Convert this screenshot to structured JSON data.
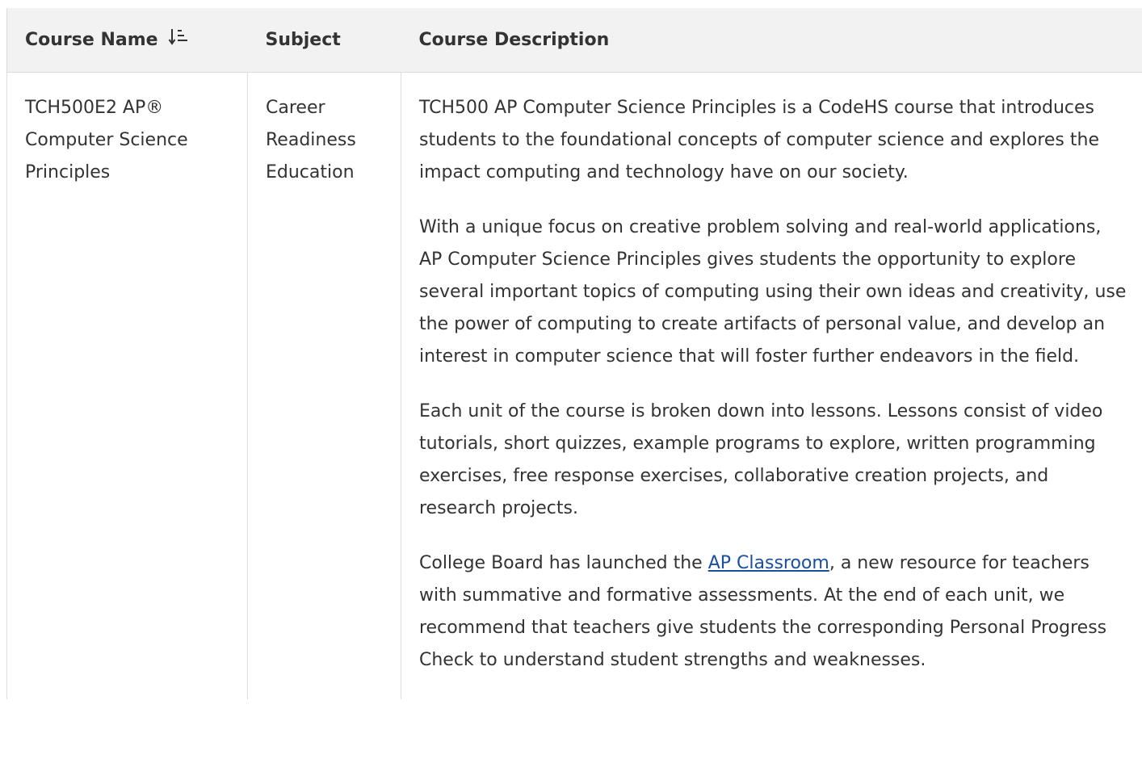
{
  "table": {
    "headers": {
      "course_name": "Course Name",
      "subject": "Subject",
      "description": "Course Description"
    },
    "sort_icon": "sort-ascending-icon",
    "rows": [
      {
        "course_name": "TCH500E2 AP® Computer Science Principles",
        "subject": "Career Readiness Education",
        "description": {
          "p1": "TCH500 AP Computer Science Principles is a CodeHS course that introduces students to the foundational concepts of computer science and explores the impact computing and technology have on our society.",
          "p2": "With a unique focus on creative problem solving and real-world applications, AP Computer Science Principles gives students the opportunity to explore several important topics of computing using their own ideas and creativity, use the power of computing to create artifacts of personal value, and develop an interest in computer science that will foster further endeavors in the field.",
          "p3": "Each unit of the course is broken down into lessons. Lessons consist of video tutorials, short quizzes, example programs to explore, written programming exercises, free response exercises, collaborative creation projects, and research projects.",
          "p4_before": "College Board has launched the ",
          "p4_link": "AP Classroom",
          "p4_after": ", a new resource for teachers with summative and formative assessments. At the end of each unit, we recommend that teachers give students the corresponding Personal Progress Check to understand student strengths and weaknesses."
        }
      }
    ]
  },
  "colors": {
    "header_bg": "#f2f2f2",
    "border": "#dcdcdc",
    "text": "#333333",
    "link": "#1a4f9c"
  }
}
